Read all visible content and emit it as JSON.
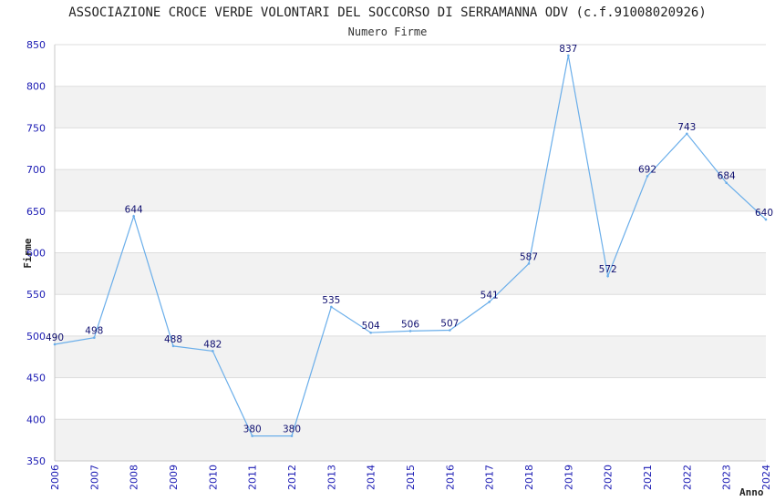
{
  "chart_data": {
    "type": "line",
    "title": "ASSOCIAZIONE CROCE VERDE VOLONTARI DEL SOCCORSO DI SERRAMANNA ODV (c.f.91008020926)",
    "subtitle": "Numero Firme",
    "xlabel": "Anno",
    "ylabel": "Firme",
    "x": [
      "2006",
      "2007",
      "2008",
      "2009",
      "2010",
      "2011",
      "2012",
      "2013",
      "2014",
      "2015",
      "2016",
      "2017",
      "2018",
      "2019",
      "2020",
      "2021",
      "2022",
      "2023",
      "2024"
    ],
    "values": [
      490,
      498,
      644,
      488,
      482,
      380,
      380,
      535,
      504,
      506,
      507,
      541,
      587,
      837,
      572,
      692,
      743,
      684,
      640
    ],
    "value_labels": [
      "490",
      "498",
      "644",
      "488",
      "482",
      "380",
      "380",
      "535",
      "504",
      "506",
      "507",
      "541",
      "587",
      "837",
      "572",
      "692",
      "743",
      "684",
      "640"
    ],
    "ylim": [
      350,
      850
    ],
    "yticks": [
      "350",
      "400",
      "450",
      "500",
      "550",
      "600",
      "650",
      "700",
      "750",
      "800",
      "850"
    ],
    "grid": true,
    "line_color": "#6aaeea",
    "band_color": "#f2f2f2",
    "grid_color": "#dddddd",
    "tick_color": "#1a1ab3"
  }
}
